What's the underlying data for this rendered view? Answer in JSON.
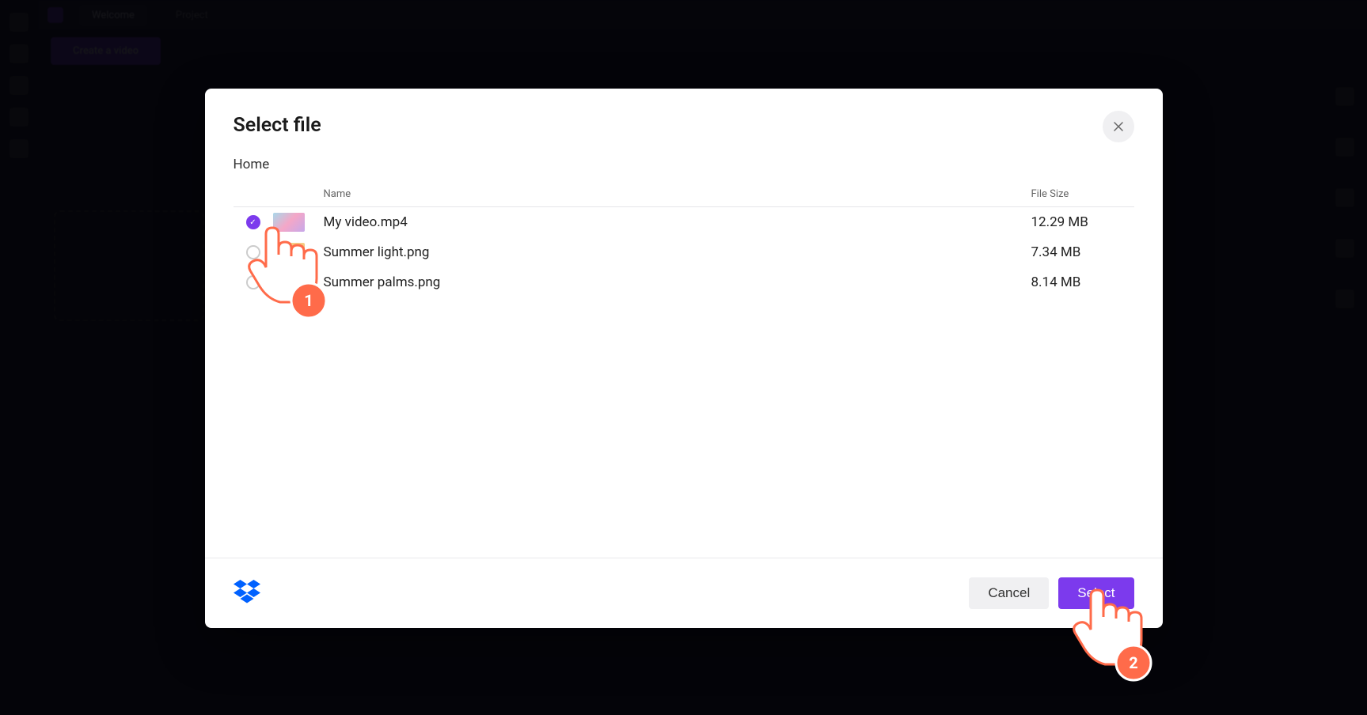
{
  "bg": {
    "tabs": [
      "Welcome",
      "Project"
    ],
    "create_btn": "Create a video"
  },
  "modal": {
    "title": "Select file",
    "breadcrumb": "Home",
    "columns": {
      "name": "Name",
      "size": "File Size"
    },
    "files": [
      {
        "name": "My video.mp4",
        "size": "12.29 MB",
        "selected": true,
        "thumb": "video"
      },
      {
        "name": "Summer light.png",
        "size": "7.34 MB",
        "selected": false,
        "thumb": "light"
      },
      {
        "name": "Summer palms.png",
        "size": "8.14 MB",
        "selected": false,
        "thumb": "palms"
      }
    ],
    "footer": {
      "provider": "dropbox",
      "cancel": "Cancel",
      "select": "Select"
    }
  },
  "annotations": [
    {
      "step": "1"
    },
    {
      "step": "2"
    }
  ]
}
